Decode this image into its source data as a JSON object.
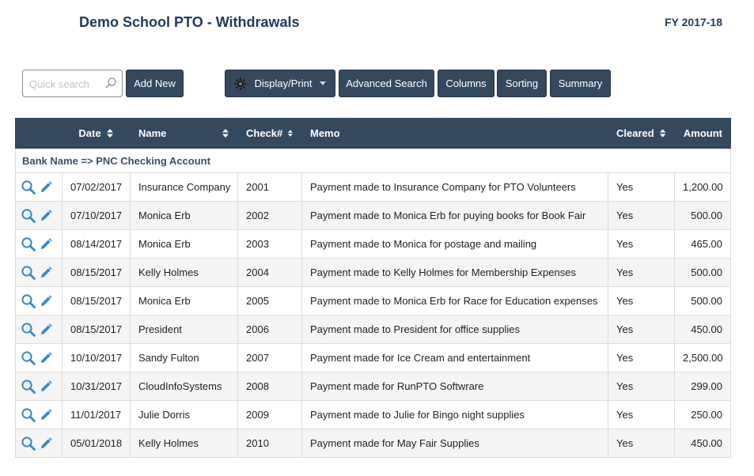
{
  "header": {
    "title": "Demo School PTO - Withdrawals",
    "fiscal_year": "FY 2017-18"
  },
  "toolbar": {
    "search_placeholder": "Quick search",
    "add_new": "Add New",
    "display_print": "Display/Print",
    "advanced_search": "Advanced Search",
    "columns": "Columns",
    "sorting": "Sorting",
    "summary": "Summary"
  },
  "table": {
    "columns": [
      "",
      "Date",
      "Name",
      "Check#",
      "Memo",
      "Cleared",
      "Amount"
    ],
    "group_label": "Bank Name => PNC Checking Account",
    "rows": [
      {
        "date": "07/02/2017",
        "name": "Insurance Company",
        "check": "2001",
        "memo": "Payment made to Insurance Company for PTO Volunteers",
        "cleared": "Yes",
        "amount": "1,200.00"
      },
      {
        "date": "07/10/2017",
        "name": "Monica Erb",
        "check": "2002",
        "memo": "Payment made to Monica Erb for puying books for Book Fair",
        "cleared": "Yes",
        "amount": "500.00"
      },
      {
        "date": "08/14/2017",
        "name": "Monica Erb",
        "check": "2003",
        "memo": "Payment made to Monica for postage and mailing",
        "cleared": "Yes",
        "amount": "465.00"
      },
      {
        "date": "08/15/2017",
        "name": "Kelly Holmes",
        "check": "2004",
        "memo": "Payment made to Kelly Holmes for Membership Expenses",
        "cleared": "Yes",
        "amount": "500.00"
      },
      {
        "date": "08/15/2017",
        "name": "Monica Erb",
        "check": "2005",
        "memo": "Payment made to Monica Erb for Race for Education expenses",
        "cleared": "Yes",
        "amount": "500.00"
      },
      {
        "date": "08/15/2017",
        "name": "President",
        "check": "2006",
        "memo": "Payment made to President for office supplies",
        "cleared": "Yes",
        "amount": "450.00"
      },
      {
        "date": "10/10/2017",
        "name": "Sandy Fulton",
        "check": "2007",
        "memo": "Payment made for Ice Cream and entertainment",
        "cleared": "Yes",
        "amount": "2,500.00"
      },
      {
        "date": "10/31/2017",
        "name": "CloudInfoSystems",
        "check": "2008",
        "memo": "Payment made for RunPTO Softwrare",
        "cleared": "Yes",
        "amount": "299.00"
      },
      {
        "date": "11/01/2017",
        "name": "Julie Dorris",
        "check": "2009",
        "memo": "Payment made to Julie for Bingo night supplies",
        "cleared": "Yes",
        "amount": "250.00"
      },
      {
        "date": "05/01/2018",
        "name": "Kelly Holmes",
        "check": "2010",
        "memo": "Payment made for May Fair Supplies",
        "cleared": "Yes",
        "amount": "450.00"
      }
    ]
  },
  "icons": {
    "view": "magnifier-icon",
    "edit": "pencil-icon",
    "search": "search-icon",
    "gear": "gear-icon",
    "caret": "caret-down-icon",
    "sort": "sort-arrows-icon"
  },
  "colors": {
    "header_bg": "#34495e",
    "title": "#1e3a5f",
    "icon_blue": "#3a87c7",
    "row_alt": "#f5f5f5"
  }
}
